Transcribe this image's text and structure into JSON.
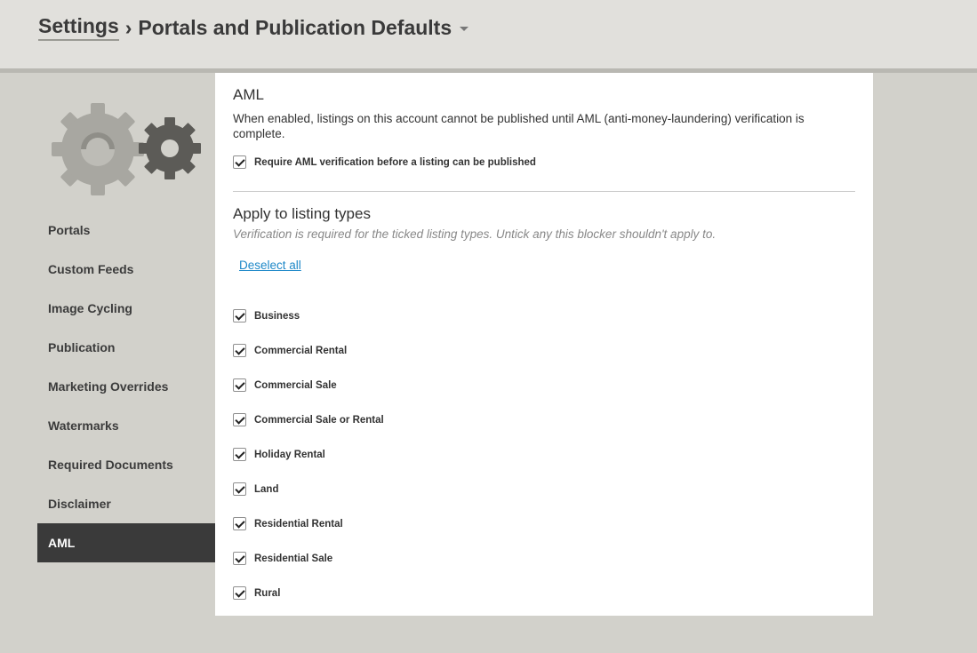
{
  "header": {
    "breadcrumb_root": "Settings",
    "breadcrumb_sep": "›",
    "breadcrumb_current": "Portals and Publication Defaults"
  },
  "sidebar": {
    "items": [
      {
        "label": "Portals"
      },
      {
        "label": "Custom Feeds"
      },
      {
        "label": "Image Cycling"
      },
      {
        "label": "Publication"
      },
      {
        "label": "Marketing Overrides"
      },
      {
        "label": "Watermarks"
      },
      {
        "label": "Required Documents"
      },
      {
        "label": "Disclaimer"
      },
      {
        "label": "AML",
        "active": true
      }
    ]
  },
  "aml": {
    "title": "AML",
    "description": "When enabled, listings on this account cannot be published until AML (anti-money-laundering) verification is complete.",
    "require_label": "Require AML verification before a listing can be published",
    "require_checked": true
  },
  "listing_types": {
    "title": "Apply to listing types",
    "hint": "Verification is required for the ticked listing types. Untick any this blocker shouldn't apply to.",
    "deselect_all": "Deselect all",
    "items": [
      {
        "label": "Business",
        "checked": true
      },
      {
        "label": "Commercial Rental",
        "checked": true
      },
      {
        "label": "Commercial Sale",
        "checked": true
      },
      {
        "label": "Commercial Sale or Rental",
        "checked": true
      },
      {
        "label": "Holiday Rental",
        "checked": true
      },
      {
        "label": "Land",
        "checked": true
      },
      {
        "label": "Residential Rental",
        "checked": true
      },
      {
        "label": "Residential Sale",
        "checked": true
      },
      {
        "label": "Rural",
        "checked": true
      }
    ]
  },
  "icons": {
    "settings_graphic": "gears-icon",
    "dropdown": "chevron-down-icon",
    "checkbox": "checkmark-icon"
  },
  "colors": {
    "active_nav": "#3a3a3a",
    "link": "#1e88c8",
    "background": "#d2d1cb"
  }
}
